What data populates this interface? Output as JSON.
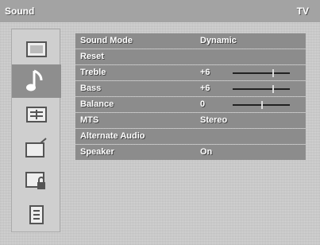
{
  "title": "Sound",
  "mode": "TV",
  "sidebar": {
    "items": [
      {
        "icon": "picture-icon"
      },
      {
        "icon": "music-note-icon",
        "active": true
      },
      {
        "icon": "features-icon"
      },
      {
        "icon": "install-icon"
      },
      {
        "icon": "lock-icon"
      },
      {
        "icon": "list-icon"
      }
    ]
  },
  "menu": {
    "rows": [
      {
        "label": "Sound Mode",
        "value": "Dynamic"
      },
      {
        "label": "Reset",
        "value": ""
      },
      {
        "label": "Treble",
        "value": "+6",
        "slider": 0.7
      },
      {
        "label": "Bass",
        "value": "+6",
        "slider": 0.7
      },
      {
        "label": "Balance",
        "value": "0",
        "slider": 0.5
      },
      {
        "label": "MTS",
        "value": "Stereo"
      },
      {
        "label": "Alternate Audio",
        "value": ""
      },
      {
        "label": "Speaker",
        "value": "On"
      }
    ]
  }
}
